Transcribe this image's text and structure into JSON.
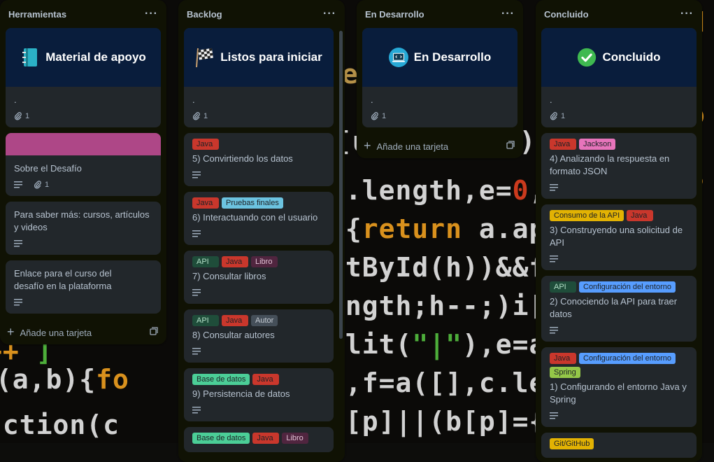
{
  "board": {
    "colors": {
      "list_bg": "#101204",
      "card_bg": "#22272b",
      "cover_navy": "#091d3c",
      "cover_pink": "#ae4787"
    }
  },
  "lists": [
    {
      "title": "Herramientas",
      "menu": "···",
      "cover_card": {
        "title": "Material de apoyo",
        "icon": "notebook-icon",
        "text": ".",
        "attachments": "1"
      },
      "cards": [
        {
          "title": "Sobre el Desafío",
          "attachments": "1"
        },
        {
          "title": "Para saber más: cursos, artículos y videos"
        },
        {
          "title": "Enlace para el curso del desafío en la plataforma"
        }
      ],
      "add_card": "Añade una tarjeta"
    },
    {
      "title": "Backlog",
      "menu": "···",
      "cover_card": {
        "title": "Listos para iniciar",
        "icon": "checkered-flag-icon",
        "text": ".",
        "attachments": "1"
      },
      "cards": [
        {
          "labels": [
            {
              "text": "Java",
              "color": "#c9372c"
            }
          ],
          "title": "5) Convirtiendo los datos"
        },
        {
          "labels": [
            {
              "text": "Java",
              "color": "#c9372c"
            },
            {
              "text": "Pruebas finales",
              "color": "#6cc3e0"
            }
          ],
          "title": "6) Interactuando con el usuario"
        },
        {
          "labels": [
            {
              "text": "API",
              "color": "#1f4d3a"
            },
            {
              "text": "Java",
              "color": "#c9372c"
            },
            {
              "text": "Libro",
              "color": "#50253f"
            }
          ],
          "title": "7) Consultar libros"
        },
        {
          "labels": [
            {
              "text": "API",
              "color": "#1f4d3a"
            },
            {
              "text": "Java",
              "color": "#c9372c"
            },
            {
              "text": "Autor",
              "color": "#454f59"
            }
          ],
          "title": "8) Consultar autores"
        },
        {
          "labels": [
            {
              "text": "Base de datos",
              "color": "#4bce97"
            },
            {
              "text": "Java",
              "color": "#c9372c"
            }
          ],
          "title": "9) Persistencia de datos"
        },
        {
          "labels": [
            {
              "text": "Base de datos",
              "color": "#4bce97"
            },
            {
              "text": "Java",
              "color": "#c9372c"
            },
            {
              "text": "Libro",
              "color": "#50253f"
            }
          ],
          "title": ""
        }
      ]
    },
    {
      "title": "En Desarrollo",
      "menu": "···",
      "cover_card": {
        "title": "En Desarrollo",
        "icon": "laptop-code-icon",
        "text": ".",
        "attachments": "1"
      },
      "cards": [],
      "add_card": "Añade una tarjeta"
    },
    {
      "title": "Concluido",
      "menu": "···",
      "cover_card": {
        "title": "Concluido",
        "icon": "check-mark-icon",
        "text": ".",
        "attachments": "1"
      },
      "cards": [
        {
          "labels": [
            {
              "text": "Java",
              "color": "#c9372c"
            },
            {
              "text": "Jackson",
              "color": "#e774bb"
            }
          ],
          "title": "4) Analizando la respuesta en formato JSON"
        },
        {
          "labels": [
            {
              "text": "Consumo de la API",
              "color": "#e2b203"
            },
            {
              "text": "Java",
              "color": "#c9372c"
            }
          ],
          "title": "3) Construyendo una solicitud de API"
        },
        {
          "labels": [
            {
              "text": "API",
              "color": "#1f4d3a"
            },
            {
              "text": "Configuración del entorno",
              "color": "#579dff"
            }
          ],
          "title": "2) Conociendo la API para traer datos"
        },
        {
          "labels": [
            {
              "text": "Java",
              "color": "#c9372c"
            },
            {
              "text": "Configuración del entorno",
              "color": "#579dff"
            },
            {
              "text": "Spring",
              "color": "#94c748"
            }
          ],
          "title": "1) Configurando el entorno Java y Spring"
        },
        {
          "labels": [
            {
              "text": "Git/GitHub",
              "color": "#e2b203"
            }
          ],
          "title": ""
        }
      ]
    }
  ]
}
